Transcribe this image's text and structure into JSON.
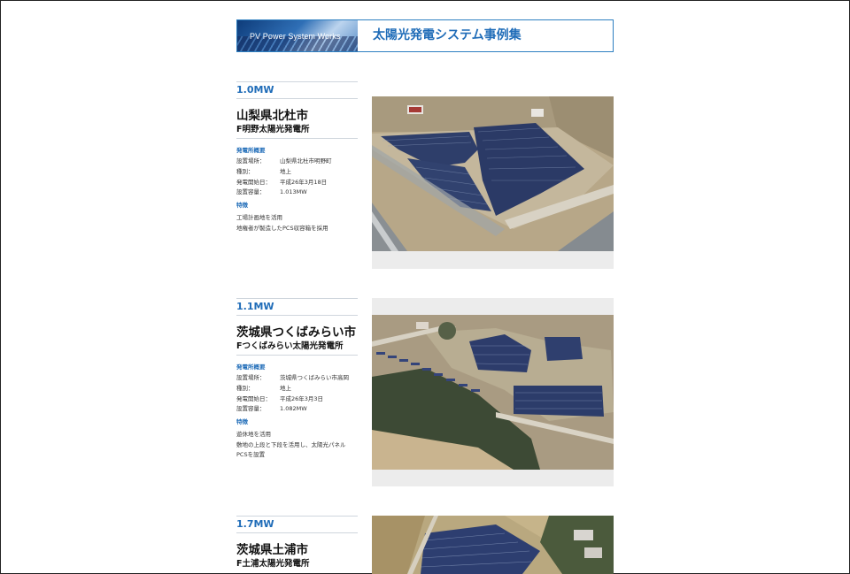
{
  "banner": {
    "en": "PV Power System Works",
    "jp": "太陽光発電システム事例集"
  },
  "cases": [
    {
      "mw": "1.0MW",
      "city": "山梨県北杜市",
      "plant": "F明野太陽光発電所",
      "overview_title": "発電所概要",
      "rows": [
        {
          "k": "設置場所：",
          "v": "山梨県北杜市明野町"
        },
        {
          "k": "種別：",
          "v": "地上"
        },
        {
          "k": "発電開始日：",
          "v": "平成26年3月18日"
        },
        {
          "k": "設置容量：",
          "v": "1.013MW"
        }
      ],
      "features_title": "特徴",
      "features": [
        "工場計画地を活用",
        "地権者が製造したPCS収容箱を採用"
      ]
    },
    {
      "mw": "1.1MW",
      "city": "茨城県つくばみらい市",
      "plant": "Fつくばみらい太陽光発電所",
      "overview_title": "発電所概要",
      "rows": [
        {
          "k": "設置場所：",
          "v": "茨城県つくばみらい市高岡"
        },
        {
          "k": "種別：",
          "v": "地上"
        },
        {
          "k": "発電開始日：",
          "v": "平成26年3月3日"
        },
        {
          "k": "設置容量：",
          "v": "1.082MW"
        }
      ],
      "features_title": "特徴",
      "features": [
        "遊休地を活用",
        "敷地の上段と下段を活用し、太陽光パネル",
        "PCSを設置"
      ]
    },
    {
      "mw": "1.7MW",
      "city": "茨城県土浦市",
      "plant": "F土浦太陽光発電所"
    }
  ]
}
